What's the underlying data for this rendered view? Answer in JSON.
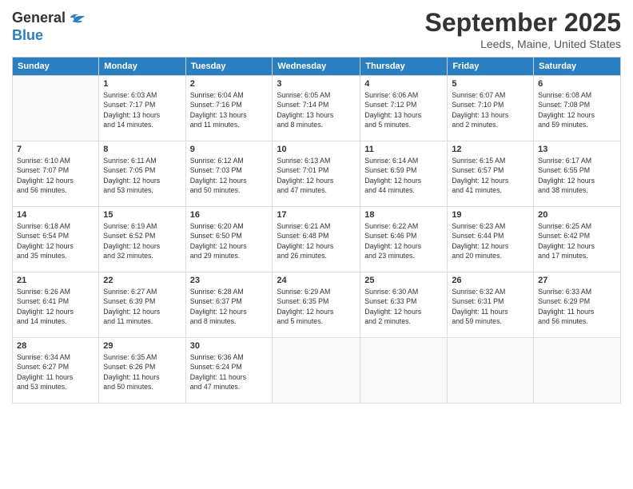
{
  "header": {
    "logo_general": "General",
    "logo_blue": "Blue",
    "month_title": "September 2025",
    "location": "Leeds, Maine, United States"
  },
  "weekdays": [
    "Sunday",
    "Monday",
    "Tuesday",
    "Wednesday",
    "Thursday",
    "Friday",
    "Saturday"
  ],
  "weeks": [
    [
      {
        "day": "",
        "info": ""
      },
      {
        "day": "1",
        "info": "Sunrise: 6:03 AM\nSunset: 7:17 PM\nDaylight: 13 hours\nand 14 minutes."
      },
      {
        "day": "2",
        "info": "Sunrise: 6:04 AM\nSunset: 7:16 PM\nDaylight: 13 hours\nand 11 minutes."
      },
      {
        "day": "3",
        "info": "Sunrise: 6:05 AM\nSunset: 7:14 PM\nDaylight: 13 hours\nand 8 minutes."
      },
      {
        "day": "4",
        "info": "Sunrise: 6:06 AM\nSunset: 7:12 PM\nDaylight: 13 hours\nand 5 minutes."
      },
      {
        "day": "5",
        "info": "Sunrise: 6:07 AM\nSunset: 7:10 PM\nDaylight: 13 hours\nand 2 minutes."
      },
      {
        "day": "6",
        "info": "Sunrise: 6:08 AM\nSunset: 7:08 PM\nDaylight: 12 hours\nand 59 minutes."
      }
    ],
    [
      {
        "day": "7",
        "info": "Sunrise: 6:10 AM\nSunset: 7:07 PM\nDaylight: 12 hours\nand 56 minutes."
      },
      {
        "day": "8",
        "info": "Sunrise: 6:11 AM\nSunset: 7:05 PM\nDaylight: 12 hours\nand 53 minutes."
      },
      {
        "day": "9",
        "info": "Sunrise: 6:12 AM\nSunset: 7:03 PM\nDaylight: 12 hours\nand 50 minutes."
      },
      {
        "day": "10",
        "info": "Sunrise: 6:13 AM\nSunset: 7:01 PM\nDaylight: 12 hours\nand 47 minutes."
      },
      {
        "day": "11",
        "info": "Sunrise: 6:14 AM\nSunset: 6:59 PM\nDaylight: 12 hours\nand 44 minutes."
      },
      {
        "day": "12",
        "info": "Sunrise: 6:15 AM\nSunset: 6:57 PM\nDaylight: 12 hours\nand 41 minutes."
      },
      {
        "day": "13",
        "info": "Sunrise: 6:17 AM\nSunset: 6:55 PM\nDaylight: 12 hours\nand 38 minutes."
      }
    ],
    [
      {
        "day": "14",
        "info": "Sunrise: 6:18 AM\nSunset: 6:54 PM\nDaylight: 12 hours\nand 35 minutes."
      },
      {
        "day": "15",
        "info": "Sunrise: 6:19 AM\nSunset: 6:52 PM\nDaylight: 12 hours\nand 32 minutes."
      },
      {
        "day": "16",
        "info": "Sunrise: 6:20 AM\nSunset: 6:50 PM\nDaylight: 12 hours\nand 29 minutes."
      },
      {
        "day": "17",
        "info": "Sunrise: 6:21 AM\nSunset: 6:48 PM\nDaylight: 12 hours\nand 26 minutes."
      },
      {
        "day": "18",
        "info": "Sunrise: 6:22 AM\nSunset: 6:46 PM\nDaylight: 12 hours\nand 23 minutes."
      },
      {
        "day": "19",
        "info": "Sunrise: 6:23 AM\nSunset: 6:44 PM\nDaylight: 12 hours\nand 20 minutes."
      },
      {
        "day": "20",
        "info": "Sunrise: 6:25 AM\nSunset: 6:42 PM\nDaylight: 12 hours\nand 17 minutes."
      }
    ],
    [
      {
        "day": "21",
        "info": "Sunrise: 6:26 AM\nSunset: 6:41 PM\nDaylight: 12 hours\nand 14 minutes."
      },
      {
        "day": "22",
        "info": "Sunrise: 6:27 AM\nSunset: 6:39 PM\nDaylight: 12 hours\nand 11 minutes."
      },
      {
        "day": "23",
        "info": "Sunrise: 6:28 AM\nSunset: 6:37 PM\nDaylight: 12 hours\nand 8 minutes."
      },
      {
        "day": "24",
        "info": "Sunrise: 6:29 AM\nSunset: 6:35 PM\nDaylight: 12 hours\nand 5 minutes."
      },
      {
        "day": "25",
        "info": "Sunrise: 6:30 AM\nSunset: 6:33 PM\nDaylight: 12 hours\nand 2 minutes."
      },
      {
        "day": "26",
        "info": "Sunrise: 6:32 AM\nSunset: 6:31 PM\nDaylight: 11 hours\nand 59 minutes."
      },
      {
        "day": "27",
        "info": "Sunrise: 6:33 AM\nSunset: 6:29 PM\nDaylight: 11 hours\nand 56 minutes."
      }
    ],
    [
      {
        "day": "28",
        "info": "Sunrise: 6:34 AM\nSunset: 6:27 PM\nDaylight: 11 hours\nand 53 minutes."
      },
      {
        "day": "29",
        "info": "Sunrise: 6:35 AM\nSunset: 6:26 PM\nDaylight: 11 hours\nand 50 minutes."
      },
      {
        "day": "30",
        "info": "Sunrise: 6:36 AM\nSunset: 6:24 PM\nDaylight: 11 hours\nand 47 minutes."
      },
      {
        "day": "",
        "info": ""
      },
      {
        "day": "",
        "info": ""
      },
      {
        "day": "",
        "info": ""
      },
      {
        "day": "",
        "info": ""
      }
    ]
  ]
}
